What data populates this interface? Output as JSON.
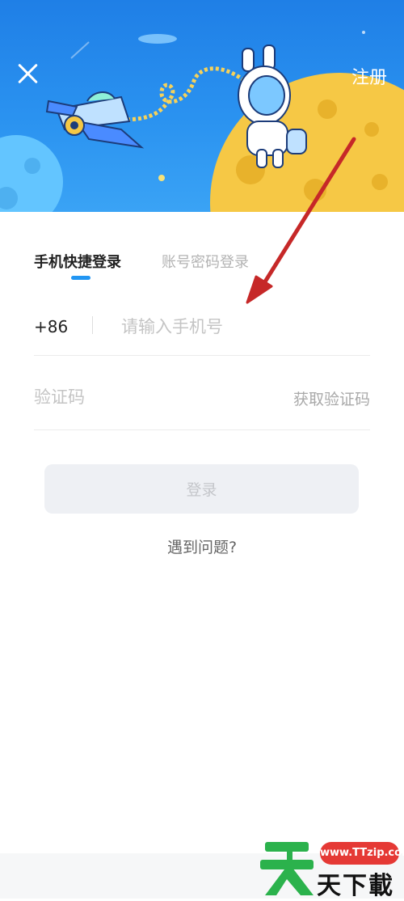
{
  "header": {
    "register_label": "注册"
  },
  "tabs": [
    {
      "label": "手机快捷登录",
      "active": true
    },
    {
      "label": "账号密码登录",
      "active": false
    }
  ],
  "phone": {
    "country_code": "+86",
    "placeholder": "请输入手机号",
    "value": ""
  },
  "verification": {
    "placeholder": "验证码",
    "value": "",
    "get_code_label": "获取验证码"
  },
  "login_button_label": "登录",
  "help_label": "遇到问题?",
  "watermark": {
    "url": "www.TTzip.com",
    "text": "天下載"
  },
  "colors": {
    "header_blue": "#2a92f0",
    "tab_indicator": "#2196f3",
    "annotation_arrow": "#c62828",
    "watermark_red": "#e53935",
    "watermark_green": "#2bb24c"
  },
  "icons": {
    "close": "close-icon",
    "illustration": "astronaut-rocket-moon-illustration"
  }
}
